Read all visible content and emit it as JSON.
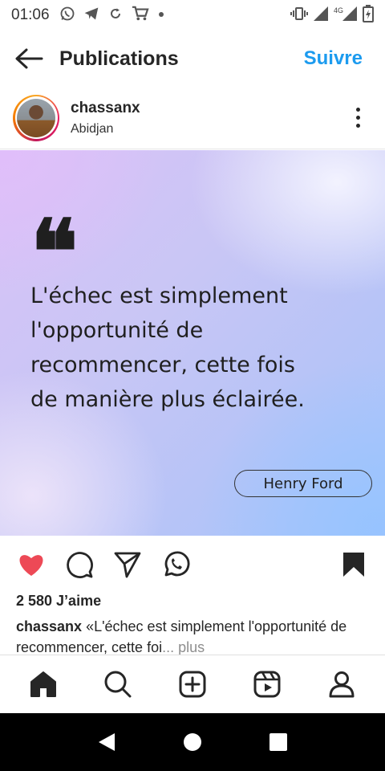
{
  "status_bar": {
    "time": "01:06",
    "network": "4G",
    "left_icons": [
      "whatsapp-icon",
      "telegram-icon",
      "sync-icon",
      "cart-icon",
      "dot-icon"
    ],
    "right_icons": [
      "vibrate-icon",
      "signal-icon",
      "signal-4g-icon",
      "battery-charging-icon"
    ]
  },
  "header": {
    "title": "Publications",
    "follow_label": "Suivre",
    "accent_color": "#1c9bef"
  },
  "post": {
    "username": "chassanx",
    "location": "Abidjan",
    "image": {
      "quote_mark": "❝",
      "quote_lines": [
        "L'échec est simplement",
        "l'opportunité de",
        "recommencer, cette fois",
        "de manière plus éclairée."
      ],
      "author": "Henry Ford"
    },
    "liked": true,
    "like_color": "#ed4956",
    "likes_text": "2 580 J’aime",
    "caption_user": "chassanx",
    "caption_text": " «L'échec est simplement l'opportunité de recommencer, cette foi",
    "caption_more": "... plus"
  },
  "bottom_nav": {
    "items": [
      "home-icon",
      "search-icon",
      "add-post-icon",
      "reels-icon",
      "profile-icon"
    ]
  },
  "system_nav": {
    "items": [
      "back-triangle-icon",
      "home-circle-icon",
      "recents-square-icon"
    ]
  }
}
